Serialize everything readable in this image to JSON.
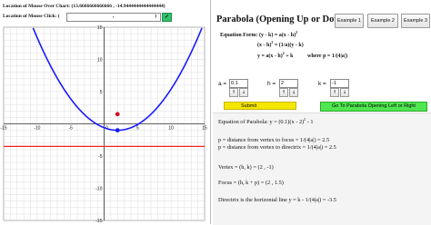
{
  "mouse_over": {
    "label": "Location of Mouse Over Chart:",
    "value": "(13.6666666666666 , -14.9444444444444444)"
  },
  "mouse_click": {
    "label": "Location of Mouse Click: (",
    "comma": ",",
    "close": ")",
    "button": "✓"
  },
  "chart_data": {
    "type": "line",
    "xlim": [
      -15,
      15
    ],
    "ylim": [
      -15,
      15
    ],
    "x_tick_labels": [
      "-15",
      "-10",
      "-5",
      "0",
      "5",
      "10",
      "15"
    ],
    "y_tick_labels": [
      "15",
      "10",
      "5",
      "-5",
      "-10",
      "-15"
    ],
    "series": [
      {
        "equation": "y = 0.1(x - 2)^2 - 1",
        "color": "#1a1aff"
      },
      {
        "equation": "y = -3.5",
        "color": "#ee2222"
      }
    ],
    "points": [
      {
        "x": 2,
        "y": -1,
        "color": "#1a1aff"
      },
      {
        "x": 2,
        "y": 1.5,
        "color": "#cc1122"
      }
    ]
  },
  "title": "Parabola (Opening Up or Down)",
  "example_buttons": [
    "Example 1",
    "Example 2",
    "Example 3"
  ],
  "equation_form": {
    "label": "Equation Form:",
    "line1": "(y - k) = a(x - h)",
    "line2": "(x - h)",
    "line2b": "= (1/a)(y - k)",
    "line3": "y = a(x - h)",
    "line3b": "+ k",
    "line3c": "where p = 1/(4|a|)",
    "sup": "2"
  },
  "params": {
    "a": {
      "label": "a =",
      "value": "0.1"
    },
    "h": {
      "label": "h =",
      "value": "2"
    },
    "k": {
      "label": "k =",
      "value": "-1"
    },
    "up": "↑",
    "down": "↓"
  },
  "submit_label": "Submit",
  "goto_label": "Go To Parabola Opening Left or Right",
  "output": {
    "line1a": "Equation of Parabola: y = (0.1)(x - 2)",
    "line1b": "- 1",
    "line2": "p = distance from vertex to focus = 1/(4|a|) = 2.5",
    "line3": "p = distance from vertex to directrix = 1/(4|a|) = 2.5",
    "line4": "Vertex = (h, k) = (2 , -1)",
    "line5": "Focus = (h, k + p) = (2 , 1.5)",
    "line6": "Directrix is the horizontal line y = k - 1/(4|a|) = -3.5",
    "sup": "2"
  }
}
